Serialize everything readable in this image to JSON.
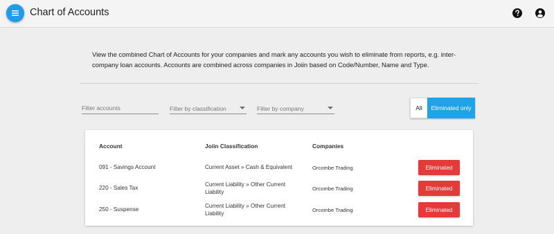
{
  "header": {
    "title": "Chart of Accounts",
    "accent_color": "#1e9be9"
  },
  "intro_text": "View the combined Chart of Accounts for your companies and mark any accounts you wish to eliminate from reports, e.g. inter-company loan accounts. Accounts are combined across companies in Joiin based on Code/Number, Name and Type.",
  "filters": {
    "accounts_placeholder": "Filter accounts",
    "classification_placeholder": "Filter by classification",
    "company_placeholder": "Filter by company"
  },
  "toggle": {
    "all_label": "All",
    "eliminated_label": "Eliminated only",
    "selected": "Eliminated only"
  },
  "table": {
    "headers": [
      "Account",
      "Joiin Classification",
      "Companies"
    ],
    "rows": [
      {
        "account": "091 - Savings Account",
        "classification": "Current Asset » Cash & Equivalent",
        "company": "Orcombe Trading",
        "action": "Eliminated"
      },
      {
        "account": "220 - Sales Tax",
        "classification": "Current Liability » Other Current Liability",
        "company": "Orcombe Trading",
        "action": "Eliminated"
      },
      {
        "account": "250 - Suspense",
        "classification": "Current Liability » Other Current Liability",
        "company": "Orcombe Trading",
        "action": "Eliminated"
      }
    ]
  },
  "icons": {
    "menu": "hamburger-menu-icon",
    "help": "help-circle-icon",
    "account": "account-circle-icon"
  },
  "status_colors": {
    "eliminated": "#e33a3a"
  }
}
